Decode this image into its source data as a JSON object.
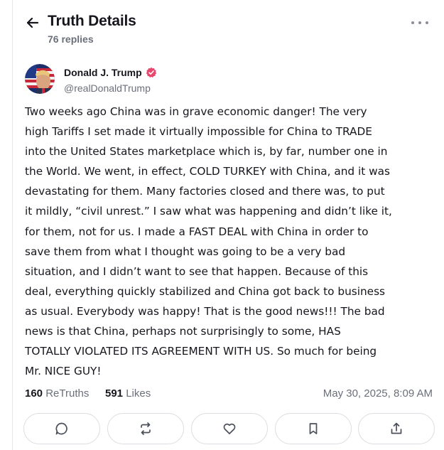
{
  "header": {
    "title": "Truth Details",
    "replies": "76 replies",
    "back_icon": "arrow-left-icon",
    "more_icon": "more-horizontal-icon"
  },
  "post": {
    "author": {
      "name": "Donald J. Trump",
      "handle": "@realDonaldTrump",
      "verified_badge_color": "#e8466d"
    },
    "lines": [
      "Two weeks ago China was in grave economic danger! The very",
      "high Tariffs I set made it virtually impossible for China to TRADE",
      "into the United States marketplace which is, by far, number one in",
      "the World. We went, in effect, COLD TURKEY with China, and it was",
      "devastating for them. Many factories closed and there was, to put",
      "it mildly, “civil unrest.” I saw what was happening and didn’t like it,",
      "for them, not for us. I made a FAST DEAL with China in order to",
      "save them from what I thought was going to be a very bad",
      "situation, and I didn’t want to see that happen. Because of this",
      "deal, everything quickly stabilized and China got back to business",
      "as usual. Everybody was happy! That is the good news!!! The bad",
      "news is that China, perhaps not surprisingly to some, HAS",
      "TOTALLY VIOLATED ITS AGREEMENT WITH US. So much for being",
      "Mr. NICE GUY!"
    ],
    "stats": {
      "retruths_count": "160",
      "retruths_label": "ReTruths",
      "likes_count": "591",
      "likes_label": "Likes"
    },
    "timestamp": "May 30, 2025, 8:09 AM"
  },
  "actions": [
    {
      "name": "reply",
      "icon": "comment-icon"
    },
    {
      "name": "retruth",
      "icon": "repost-icon"
    },
    {
      "name": "like",
      "icon": "heart-icon"
    },
    {
      "name": "bookmark",
      "icon": "bookmark-icon"
    },
    {
      "name": "share",
      "icon": "share-icon"
    }
  ],
  "colors": {
    "text": "#16161d",
    "muted": "#6b6f7a",
    "border": "#dcdde2"
  }
}
